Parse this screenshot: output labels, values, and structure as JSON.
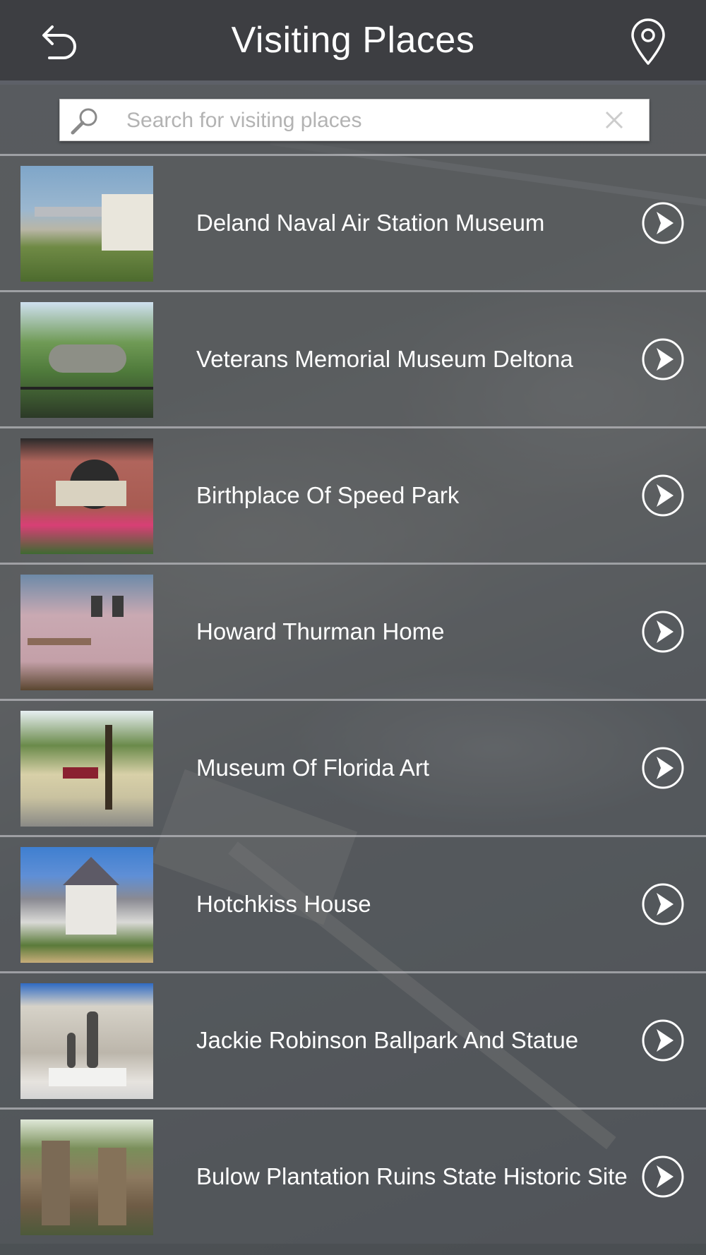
{
  "header": {
    "title": "Visiting Places",
    "back_icon": "back-arrow-icon",
    "location_icon": "map-pin-icon"
  },
  "search": {
    "placeholder": "Search for visiting places",
    "value": ""
  },
  "places": [
    {
      "name": "Deland Naval Air Station Museum"
    },
    {
      "name": "Veterans Memorial Museum Deltona"
    },
    {
      "name": "Birthplace Of Speed Park"
    },
    {
      "name": "Howard Thurman Home"
    },
    {
      "name": "Museum Of Florida Art"
    },
    {
      "name": "Hotchkiss House"
    },
    {
      "name": "Jackie Robinson Ballpark And Statue"
    },
    {
      "name": "Bulow Plantation Ruins State Historic Site"
    }
  ],
  "colors": {
    "header_bg": "#3d3e42",
    "text": "#ffffff",
    "divider": "#cdcdd2"
  }
}
